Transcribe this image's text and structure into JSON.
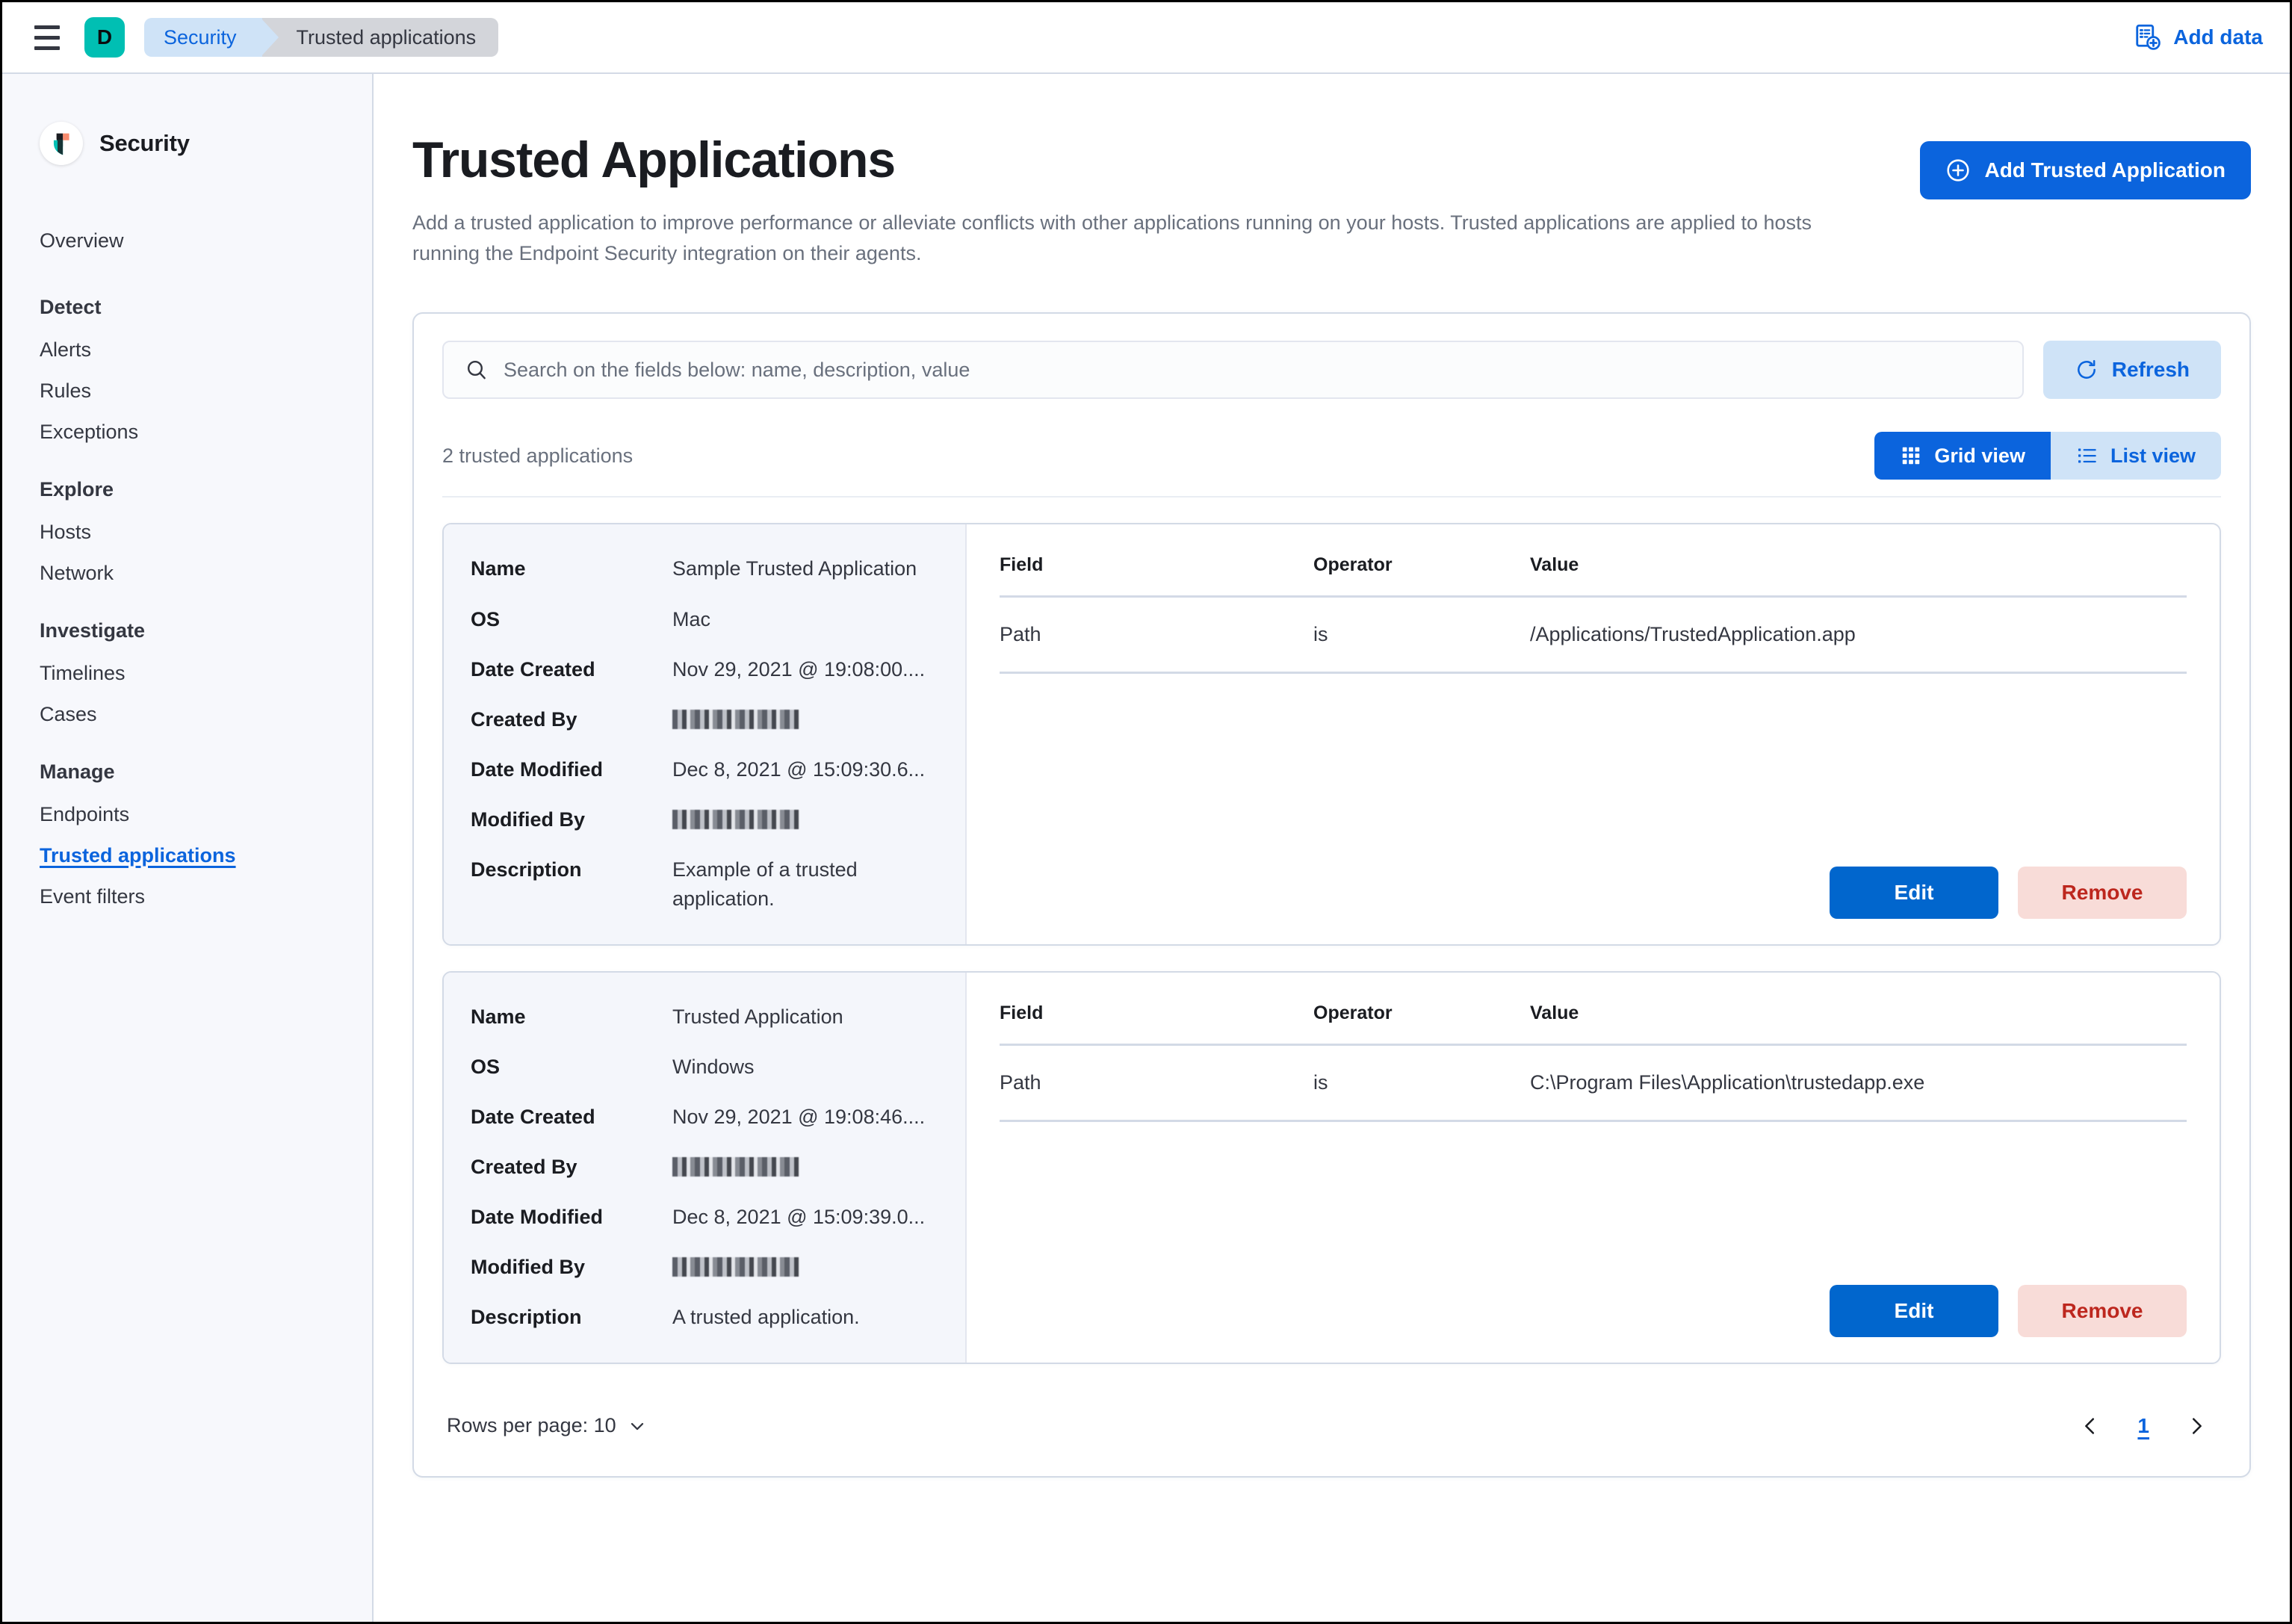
{
  "topbar": {
    "menu_icon": "hamburger-icon",
    "avatar_initial": "D",
    "breadcrumb_1": "Security",
    "breadcrumb_2": "Trusted applications",
    "add_data_label": "Add data",
    "add_data_icon": "add-data-icon"
  },
  "sidebar": {
    "brand": "Security",
    "brand_logo_icon": "elastic-security-shield-icon",
    "top_item": "Overview",
    "groups": [
      {
        "heading": "Detect",
        "items": [
          "Alerts",
          "Rules",
          "Exceptions"
        ]
      },
      {
        "heading": "Explore",
        "items": [
          "Hosts",
          "Network"
        ]
      },
      {
        "heading": "Investigate",
        "items": [
          "Timelines",
          "Cases"
        ]
      },
      {
        "heading": "Manage",
        "items": [
          "Endpoints",
          "Trusted applications",
          "Event filters"
        ]
      }
    ],
    "active_item": "Trusted applications"
  },
  "page": {
    "title": "Trusted Applications",
    "description": "Add a trusted application to improve performance or alleviate conflicts with other applications running on your hosts. Trusted applications are applied to hosts running the Endpoint Security integration on their agents.",
    "add_button": "Add Trusted Application",
    "add_button_icon": "plus-in-circle-icon"
  },
  "toolbar": {
    "search_placeholder": "Search on the fields below: name, description, value",
    "search_value": "",
    "search_icon": "search-icon",
    "refresh_label": "Refresh",
    "refresh_icon": "refresh-icon",
    "count_text": "2 trusted applications",
    "grid_view_label": "Grid view",
    "grid_view_icon": "grid-icon",
    "list_view_label": "List view",
    "list_view_icon": "list-icon",
    "active_view": "Grid view"
  },
  "field_labels": {
    "name": "Name",
    "os": "OS",
    "date_created": "Date Created",
    "created_by": "Created By",
    "date_modified": "Date Modified",
    "modified_by": "Modified By",
    "description": "Description"
  },
  "table_headers": {
    "field": "Field",
    "operator": "Operator",
    "value": "Value"
  },
  "card_actions": {
    "edit": "Edit",
    "remove": "Remove"
  },
  "cards": [
    {
      "name": "Sample Trusted Application",
      "os": "Mac",
      "date_created": "Nov 29, 2021 @ 19:08:00....",
      "created_by": "",
      "date_modified": "Dec 8, 2021 @ 15:09:30.6...",
      "modified_by": "",
      "description": "Example of a trusted application.",
      "conditions": [
        {
          "field": "Path",
          "operator": "is",
          "value": "/Applications/TrustedApplication.app"
        }
      ]
    },
    {
      "name": "Trusted Application",
      "os": "Windows",
      "date_created": "Nov 29, 2021 @ 19:08:46....",
      "created_by": "",
      "date_modified": "Dec 8, 2021 @ 15:09:39.0...",
      "modified_by": "",
      "description": "A trusted application.",
      "conditions": [
        {
          "field": "Path",
          "operator": "is",
          "value": "C:\\Program Files\\Application\\trustedapp.exe"
        }
      ]
    }
  ],
  "pagination": {
    "rows_per_page_label": "Rows per page: 10",
    "chevron_icon": "chevron-down-icon",
    "prev_icon": "chevron-left-icon",
    "next_icon": "chevron-right-icon",
    "current_page": "1"
  },
  "colors": {
    "accent_blue": "#0b64dd",
    "avatar_teal": "#00bfb3",
    "danger_red": "#bd271e"
  }
}
